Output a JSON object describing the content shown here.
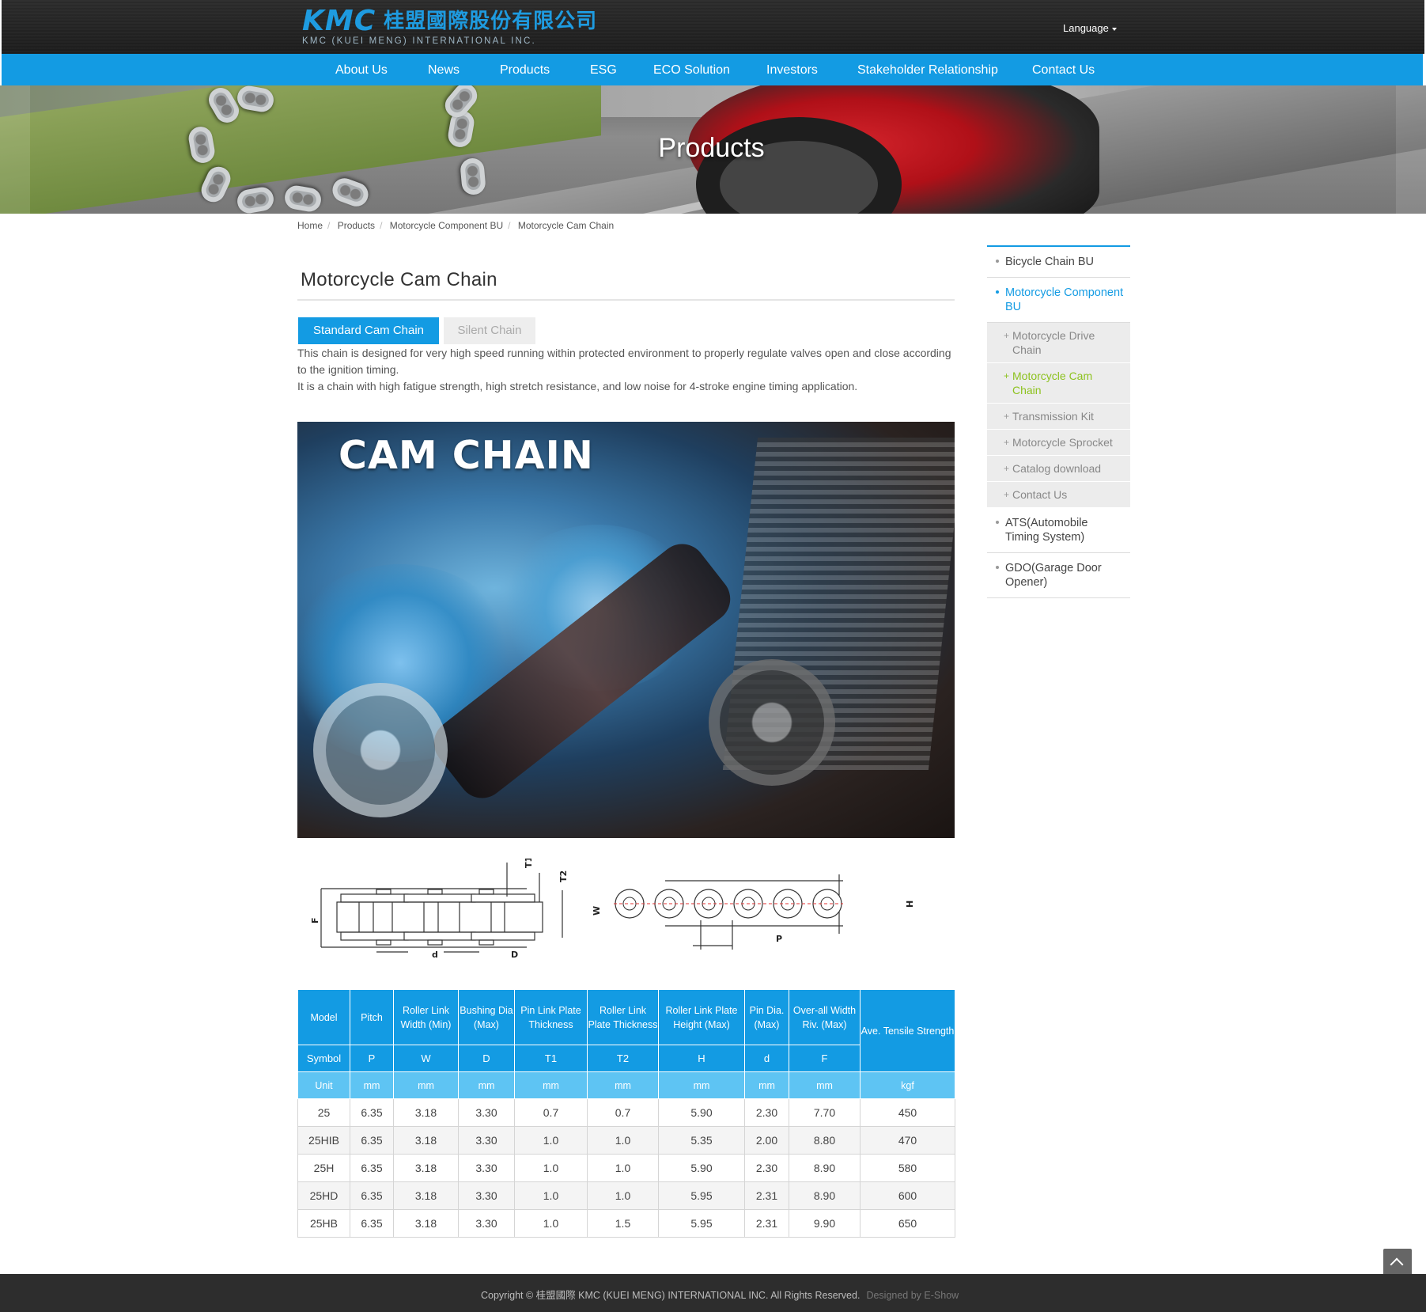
{
  "header": {
    "logo_kmc": "KMC",
    "logo_cn": "桂盟國際股份有限公司",
    "logo_en": "KMC (KUEI MENG) INTERNATIONAL INC.",
    "language": "Language"
  },
  "nav": [
    "About Us",
    "News",
    "Products",
    "ESG",
    "ECO Solution",
    "Investors",
    "Stakeholder Relationship",
    "Contact Us"
  ],
  "banner": {
    "title": "Products"
  },
  "breadcrumb": [
    "Home",
    "Products",
    "Motorcycle Component BU",
    "Motorcycle Cam Chain"
  ],
  "page_title": "Motorcycle Cam Chain",
  "tabs": {
    "active": "Standard Cam Chain",
    "inactive": "Silent Chain"
  },
  "description": {
    "line1": "This chain is designed for very high speed running within protected environment to properly regulate valves open and close according to the ignition timing.",
    "line2": "It is a chain with high fatigue strength, high stretch resistance, and low noise for 4-stroke engine timing application."
  },
  "hero": {
    "title": "CAM CHAIN"
  },
  "diagram_labels": {
    "t1": "T1",
    "t2": "T2",
    "w": "W",
    "f": "F",
    "d_small": "d",
    "d_big": "D",
    "h": "H",
    "p": "P"
  },
  "table": {
    "headers": [
      "Model",
      "Pitch",
      "Roller Link Width (Min)",
      "Bushing Dia (Max)",
      "Pin Link Plate Thickness",
      "Roller Link Plate Thickness",
      "Roller Link Plate Height (Max)",
      "Pin Dia. (Max)",
      "Over-all Width Riv. (Max)",
      "Ave. Tensile Strength"
    ],
    "symbols": [
      "Symbol",
      "P",
      "W",
      "D",
      "T1",
      "T2",
      "H",
      "d",
      "F"
    ],
    "units": [
      "Unit",
      "mm",
      "mm",
      "mm",
      "mm",
      "mm",
      "mm",
      "mm",
      "mm",
      "kgf"
    ],
    "rows": [
      [
        "25",
        "6.35",
        "3.18",
        "3.30",
        "0.7",
        "0.7",
        "5.90",
        "2.30",
        "7.70",
        "450"
      ],
      [
        "25HIB",
        "6.35",
        "3.18",
        "3.30",
        "1.0",
        "1.0",
        "5.35",
        "2.00",
        "8.80",
        "470"
      ],
      [
        "25H",
        "6.35",
        "3.18",
        "3.30",
        "1.0",
        "1.0",
        "5.90",
        "2.30",
        "8.90",
        "580"
      ],
      [
        "25HD",
        "6.35",
        "3.18",
        "3.30",
        "1.0",
        "1.0",
        "5.95",
        "2.31",
        "8.90",
        "600"
      ],
      [
        "25HB",
        "6.35",
        "3.18",
        "3.30",
        "1.0",
        "1.5",
        "5.95",
        "2.31",
        "9.90",
        "650"
      ]
    ]
  },
  "sidebar": {
    "items": [
      {
        "label": "Bicycle Chain BU"
      },
      {
        "label": "Motorcycle Component BU"
      },
      {
        "label": "ATS(Automobile Timing System)"
      },
      {
        "label": "GDO(Garage Door Opener)"
      }
    ],
    "subitems": [
      "Motorcycle Drive Chain",
      "Motorcycle Cam Chain",
      "Transmission Kit",
      "Motorcycle Sprocket",
      "Catalog download",
      "Contact Us"
    ]
  },
  "footer": {
    "copyright": "Copyright © 桂盟國際 KMC (KUEI MENG) INTERNATIONAL INC. All Rights Reserved.",
    "designer": "Designed by E-Show"
  },
  "colors": {
    "primary": "#139be3",
    "nav_bg": "#139be3",
    "current_sub": "#8dc21f",
    "footer_bg": "#2d2d2d"
  },
  "icons": {
    "language_caret": "caret-down-icon",
    "back_to_top": "chevron-up-icon"
  }
}
